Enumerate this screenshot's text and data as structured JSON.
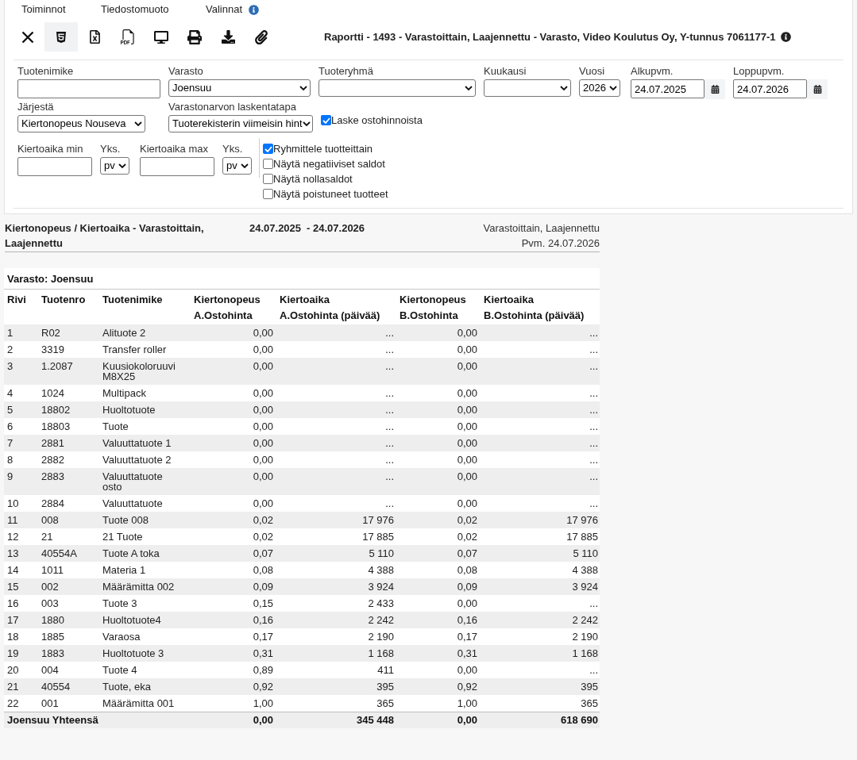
{
  "menu": [
    {
      "label": "Toiminnot",
      "info": false
    },
    {
      "label": "Tiedostomuoto",
      "info": false
    },
    {
      "label": "Valinnat",
      "info": true
    }
  ],
  "toolbar": [
    {
      "kind": "close",
      "selected": false
    },
    {
      "kind": "html",
      "selected": true
    },
    {
      "kind": "excel",
      "selected": false
    },
    {
      "kind": "pdf",
      "selected": false
    },
    {
      "kind": "screen",
      "selected": false
    },
    {
      "kind": "print",
      "selected": false
    },
    {
      "kind": "download",
      "selected": false
    },
    {
      "kind": "attach",
      "selected": false
    }
  ],
  "report_title": {
    "text": "Raportti - 1493 - Varastoittain, Laajennettu - Varasto, Video Koulutus Oy, Y-tunnus 7061177-1",
    "info": true
  },
  "filters": {
    "row_1": [
      {
        "kind": "text",
        "label": "Tuotenimike"
      },
      {
        "kind": "select",
        "label": "Varasto",
        "value": "Joensuu"
      },
      {
        "kind": "select",
        "label": "Tuoteryhmä"
      },
      {
        "kind": "select",
        "label": "Kuukausi"
      },
      {
        "kind": "select",
        "label": "Vuosi",
        "value": "2026"
      },
      {
        "kind": "date",
        "label": "Alkupvm.",
        "value": "24.07.2025"
      },
      {
        "kind": "date",
        "label": "Loppupvm.",
        "value": "24.07.2026"
      }
    ],
    "row_2": [
      {
        "kind": "select",
        "label": "Järjestä",
        "value": "Kiertonopeus Nouseva"
      },
      {
        "kind": "select",
        "label": "Varastonarvon laskentatapa",
        "value": "Tuoterekisterin viimeisin hint"
      },
      {
        "kind": "checkbox",
        "label": "Laske ostohinnoista",
        "checked": true
      }
    ],
    "row_3": [
      {
        "kind": "text",
        "label": "Kiertoaika min"
      },
      {
        "kind": "select",
        "label": "Yks.",
        "value": "pv"
      },
      {
        "kind": "text",
        "label": "Kiertoaika max"
      },
      {
        "kind": "select",
        "label": "Yks.",
        "value": "pv"
      }
    ],
    "options": [
      {
        "label": "Ryhmittele tuotteittain",
        "checked": true
      },
      {
        "label": "Näytä negatiiviset saldot",
        "checked": false
      },
      {
        "label": "Näytä nollasaldot",
        "checked": false
      },
      {
        "label": "Näytä poistuneet tuotteet",
        "checked": false
      }
    ]
  },
  "report": {
    "title": "Kiertonopeus / Kiertoaika - Varastoittain, Laajennettu",
    "period": [
      "24.07.2025",
      "- 24.07.2026"
    ],
    "subtitle": "Varastoittain, Laajennettu",
    "date": "Pvm. 24.07.2026"
  },
  "table": {
    "group": "Varasto: Joensuu",
    "columns": [
      "Rivi",
      "Tuotenro",
      "Tuotenimike",
      "Kiertonopeus A.Ostohinta",
      "Kiertoaika A.Ostohinta (päivää)",
      "Kiertonopeus B.Ostohinta",
      "Kiertoaika B.Ostohinta (päivää)"
    ],
    "rows": [
      [
        "1",
        "R02",
        "Alituote 2",
        "0,00",
        "...",
        "0,00",
        "..."
      ],
      [
        "2",
        "3319",
        "Transfer roller",
        "0,00",
        "...",
        "0,00",
        "..."
      ],
      [
        "3",
        "1.2087",
        "Kuusiokoloruuvi M8X25",
        "0,00",
        "...",
        "0,00",
        "..."
      ],
      [
        "4",
        "1024",
        "Multipack",
        "0,00",
        "...",
        "0,00",
        "..."
      ],
      [
        "5",
        "18802",
        "Huoltotuote",
        "0,00",
        "...",
        "0,00",
        "..."
      ],
      [
        "6",
        "18803",
        "Tuote",
        "0,00",
        "...",
        "0,00",
        "..."
      ],
      [
        "7",
        "2881",
        "Valuuttatuote 1",
        "0,00",
        "...",
        "0,00",
        "..."
      ],
      [
        "8",
        "2882",
        "Valuuttatuote 2",
        "0,00",
        "...",
        "0,00",
        "..."
      ],
      [
        "9",
        "2883",
        "Valuuttatuote osto",
        "0,00",
        "...",
        "0,00",
        "..."
      ],
      [
        "10",
        "2884",
        "Valuuttatuote",
        "0,00",
        "...",
        "0,00",
        "..."
      ],
      [
        "11",
        "008",
        "Tuote 008",
        "0,02",
        "17 976",
        "0,02",
        "17 976"
      ],
      [
        "12",
        "21",
        "21 Tuote",
        "0,02",
        "17 885",
        "0,02",
        "17 885"
      ],
      [
        "13",
        "40554A",
        "Tuote A toka",
        "0,07",
        "5 110",
        "0,07",
        "5 110"
      ],
      [
        "14",
        "1011",
        "Materia 1",
        "0,08",
        "4 388",
        "0,08",
        "4 388"
      ],
      [
        "15",
        "002",
        "Määrämitta 002",
        "0,09",
        "3 924",
        "0,09",
        "3 924"
      ],
      [
        "16",
        "003",
        "Tuote 3",
        "0,15",
        "2 433",
        "0,00",
        "..."
      ],
      [
        "17",
        "1880",
        "Huoltotuote4",
        "0,16",
        "2 242",
        "0,16",
        "2 242"
      ],
      [
        "18",
        "1885",
        "Varaosa",
        "0,17",
        "2 190",
        "0,17",
        "2 190"
      ],
      [
        "19",
        "1883",
        "Huoltotuote 3",
        "0,31",
        "1 168",
        "0,31",
        "1 168"
      ],
      [
        "20",
        "004",
        "Tuote 4",
        "0,89",
        "411",
        "0,00",
        "..."
      ],
      [
        "21",
        "40554",
        "Tuote, eka",
        "0,92",
        "395",
        "0,92",
        "395"
      ],
      [
        "22",
        "001",
        "Määrämitta 001",
        "1,00",
        "365",
        "1,00",
        "365"
      ]
    ],
    "total": {
      "label": "Joensuu Yhteensä",
      "values": [
        "0,00",
        "345 448",
        "0,00",
        "618 690"
      ]
    }
  }
}
